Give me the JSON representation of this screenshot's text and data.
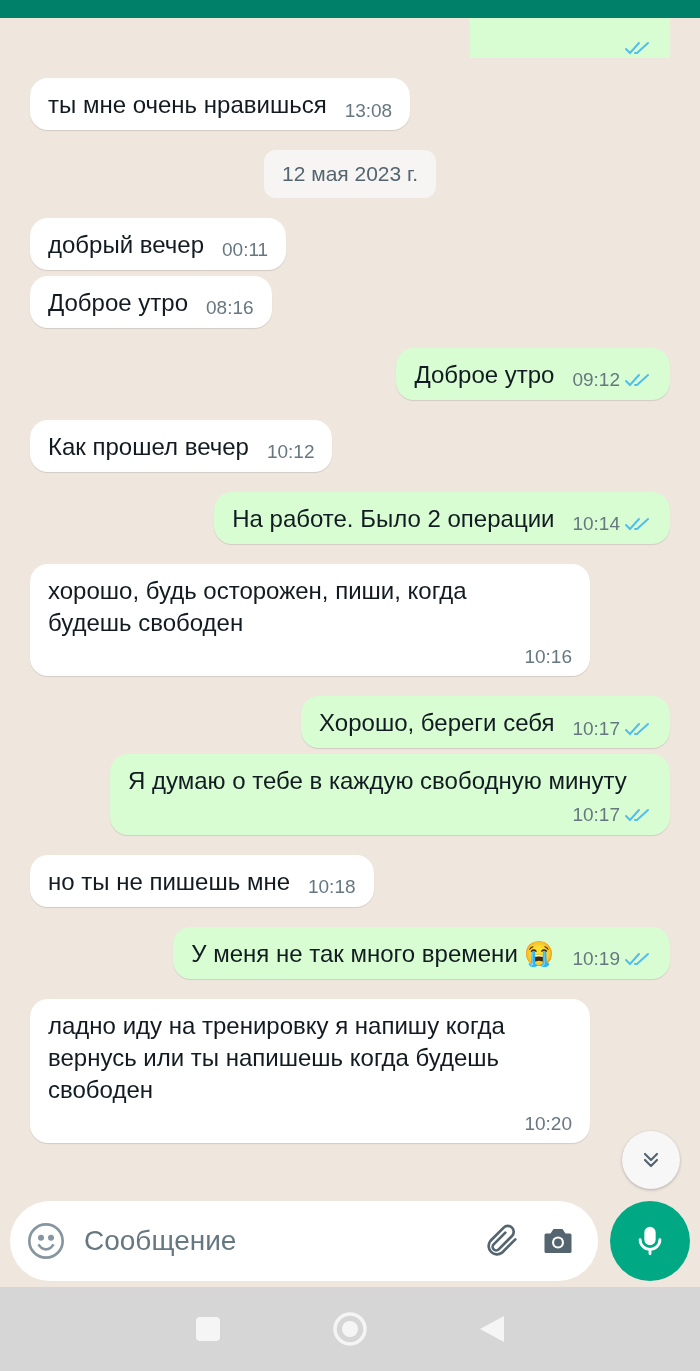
{
  "messages": [
    {
      "kind": "partial",
      "outgoing": true,
      "read": true
    },
    {
      "kind": "message",
      "outgoing": false,
      "text": "ты мне очень нравишься",
      "time": "13:08"
    },
    {
      "kind": "date",
      "text": "12 мая 2023 г."
    },
    {
      "kind": "message",
      "outgoing": false,
      "text": "добрый вечер",
      "time": "00:11"
    },
    {
      "kind": "message",
      "outgoing": false,
      "text": "Доброе утро",
      "time": "08:16"
    },
    {
      "kind": "message",
      "outgoing": true,
      "text": "Доброе утро",
      "time": "09:12",
      "read": true
    },
    {
      "kind": "message",
      "outgoing": false,
      "text": "Как прошел вечер",
      "time": "10:12"
    },
    {
      "kind": "message",
      "outgoing": true,
      "text": "На работе. Было 2 операции",
      "time": "10:14",
      "read": true
    },
    {
      "kind": "message",
      "outgoing": false,
      "text": "хорошо, будь осторожен, пиши, когда будешь свободен",
      "time": "10:16"
    },
    {
      "kind": "message",
      "outgoing": true,
      "text": "Хорошо, береги себя",
      "time": "10:17",
      "read": true
    },
    {
      "kind": "message",
      "outgoing": true,
      "text": "Я думаю о тебе в каждую свободную минуту",
      "time": "10:17",
      "read": true
    },
    {
      "kind": "message",
      "outgoing": false,
      "text": "но ты не пишешь мне",
      "time": "10:18"
    },
    {
      "kind": "message",
      "outgoing": true,
      "text": "У меня не так много времени 😭",
      "time": "10:19",
      "read": true
    },
    {
      "kind": "message",
      "outgoing": false,
      "text": "ладно иду на тренировку я напишу когда вернусь или ты напишешь когда будешь свободен",
      "time": "10:20"
    }
  ],
  "composer": {
    "placeholder": "Сообщение"
  }
}
